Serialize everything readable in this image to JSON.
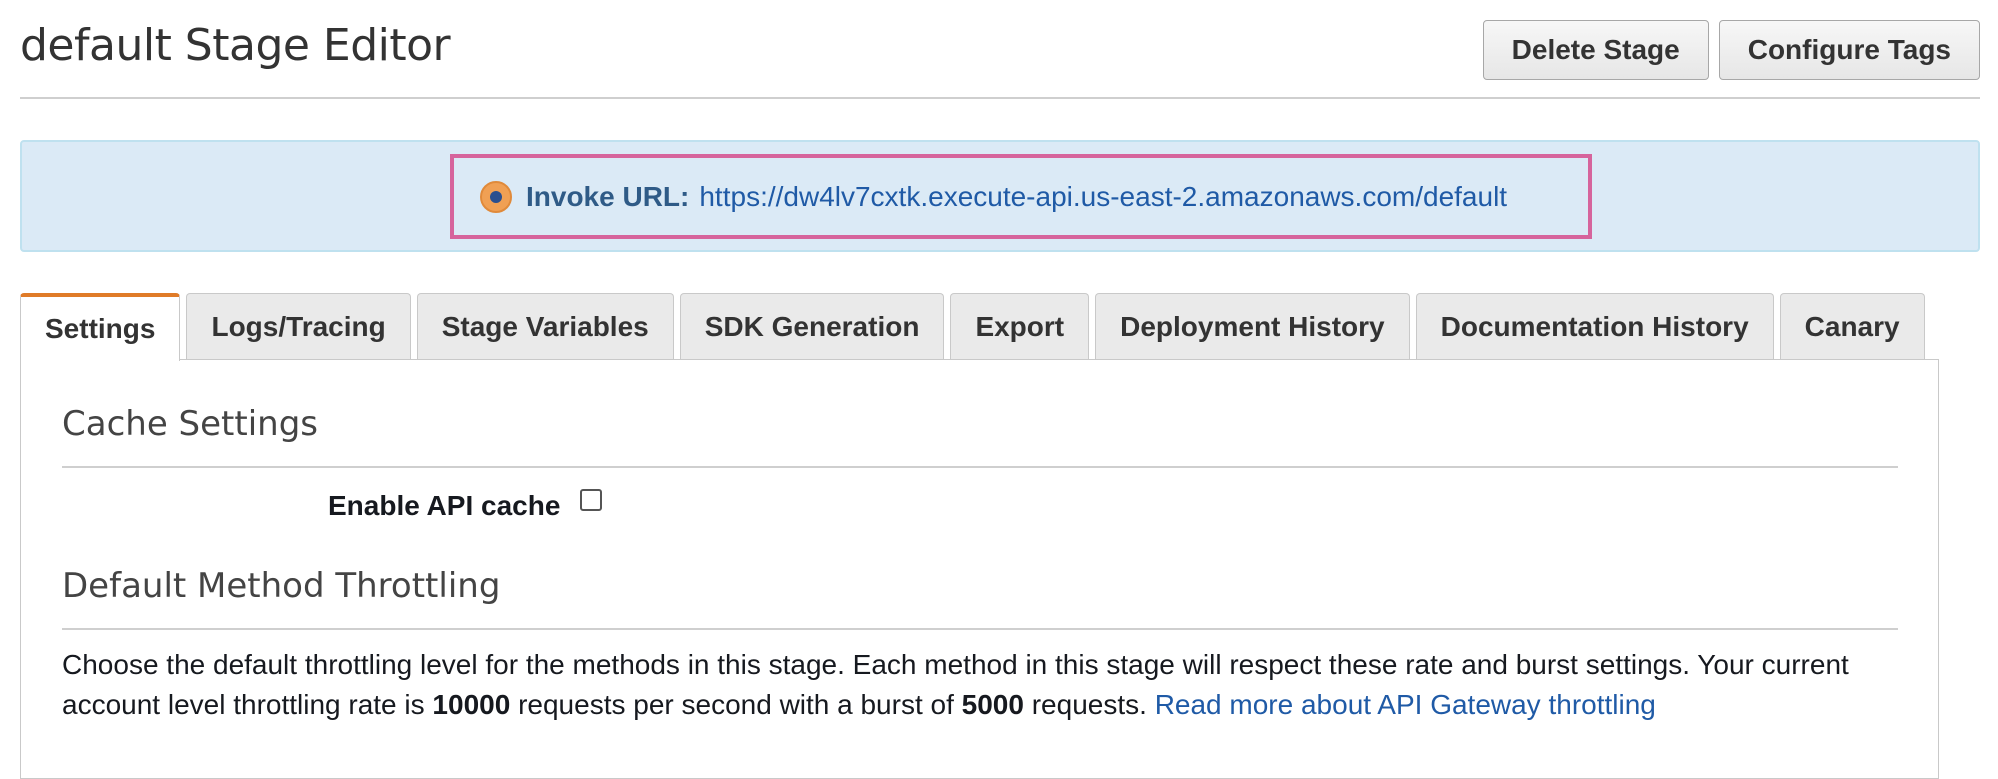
{
  "header": {
    "title": "default Stage Editor",
    "delete_button": "Delete Stage",
    "tags_button": "Configure Tags"
  },
  "invoke": {
    "label": "Invoke URL:",
    "url": "https://dw4lv7cxtk.execute-api.us-east-2.amazonaws.com/default"
  },
  "tabs": [
    {
      "label": "Settings",
      "active": true
    },
    {
      "label": "Logs/Tracing",
      "active": false
    },
    {
      "label": "Stage Variables",
      "active": false
    },
    {
      "label": "SDK Generation",
      "active": false
    },
    {
      "label": "Export",
      "active": false
    },
    {
      "label": "Deployment History",
      "active": false
    },
    {
      "label": "Documentation History",
      "active": false
    },
    {
      "label": "Canary",
      "active": false
    }
  ],
  "cache_settings": {
    "heading": "Cache Settings",
    "enable_label": "Enable API cache",
    "enabled": false
  },
  "throttling": {
    "heading": "Default Method Throttling",
    "text_part1": "Choose the default throttling level for the methods in this stage. Each method in this stage will respect these rate and burst settings. Your current account level throttling rate is ",
    "rate": "10000",
    "text_part2": " requests per second with a burst of ",
    "burst": "5000",
    "text_part3": " requests. ",
    "link": "Read more about API Gateway throttling"
  },
  "colors": {
    "active_tab_accent": "#e07b28",
    "link": "#1f5aa6",
    "banner_bg": "#dbeaf6",
    "highlight_border": "#d6649c"
  }
}
